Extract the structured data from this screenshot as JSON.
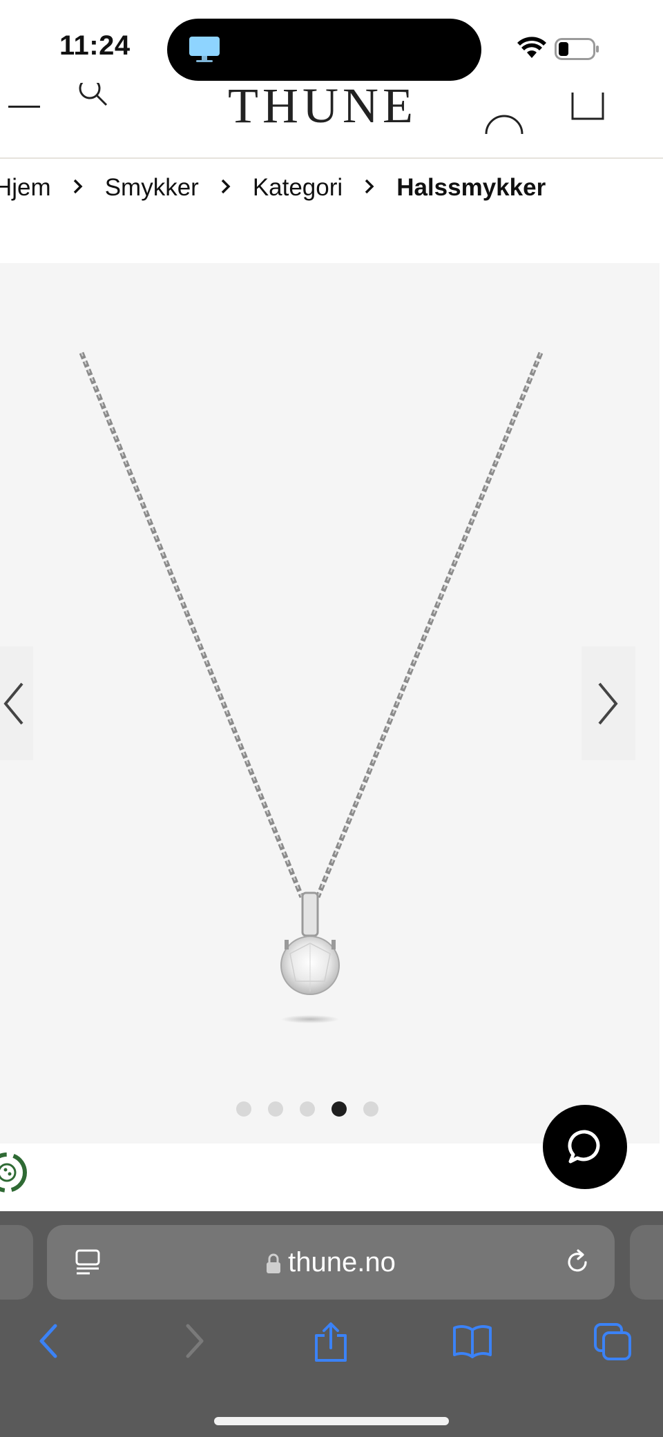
{
  "status_bar": {
    "time": "11:24"
  },
  "header": {
    "logo_text": "THUNE"
  },
  "breadcrumb": {
    "items": [
      "Hjem",
      "Smykker",
      "Kategori",
      "Halssmykker"
    ],
    "separator": "›"
  },
  "gallery": {
    "image_subject": "necklace-pendant",
    "slide_count": 5,
    "active_slide": 4
  },
  "browser": {
    "url": "thune.no"
  },
  "colors": {
    "browser_accent": "#3b82f6",
    "gallery_bg": "#f5f5f5",
    "chrome_bg": "#5a5a5a"
  }
}
